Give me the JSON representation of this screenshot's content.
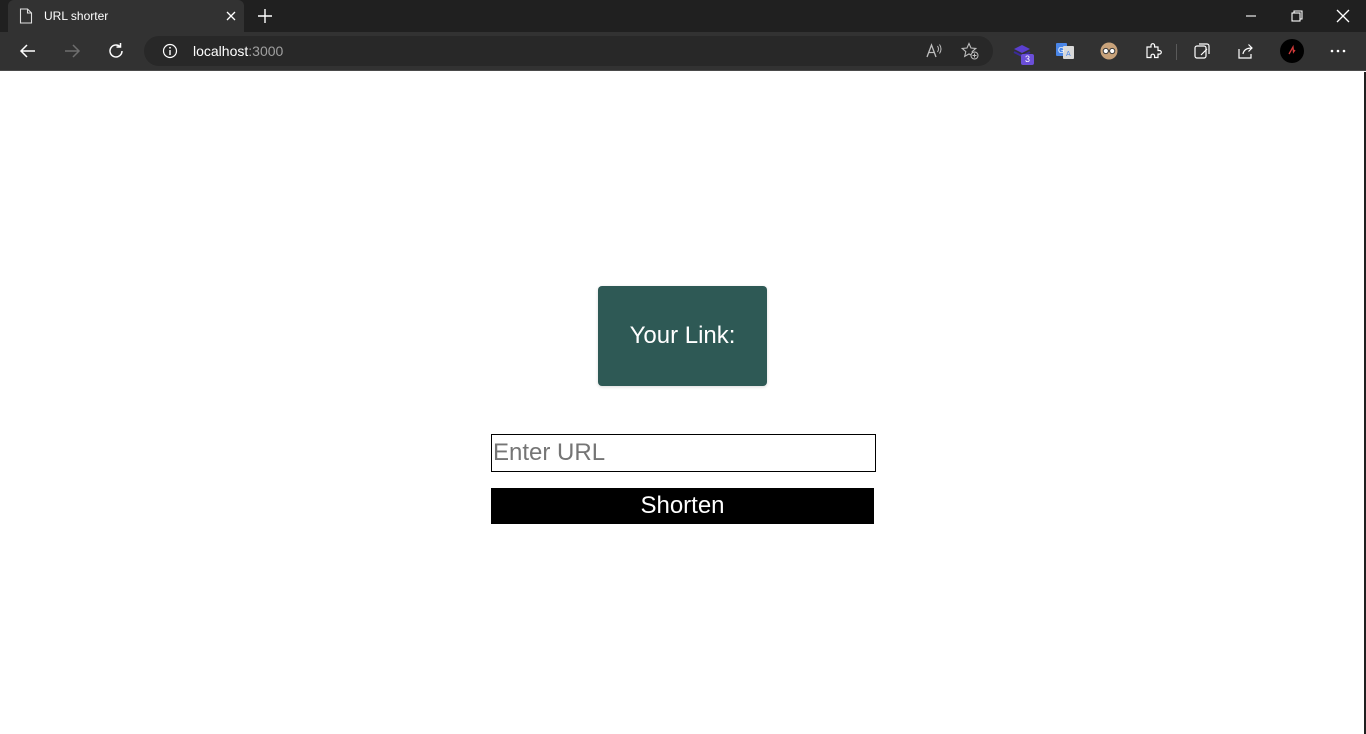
{
  "browser": {
    "tab_title": "URL shorter",
    "address_host": "localhost",
    "address_port": ":3000",
    "extension_badge": "3"
  },
  "page": {
    "link_label": "Your Link:",
    "url_input_placeholder": "Enter URL",
    "url_input_value": "",
    "shorten_button_label": "Shorten"
  },
  "colors": {
    "chrome_dark": "#202020",
    "toolbar": "#323232",
    "card_bg": "#2e5955",
    "button_bg": "#000000"
  },
  "icons": {
    "tab": "page-icon",
    "close_tab": "close-icon",
    "new_tab": "plus-icon",
    "back": "back-arrow-icon",
    "forward": "forward-arrow-icon",
    "reload": "reload-icon",
    "site_info": "info-icon",
    "read_aloud": "read-aloud-icon",
    "favorite": "favorite-add-icon",
    "extensions": "puzzle-icon",
    "collections": "collections-icon",
    "share": "share-icon",
    "menu": "more-icon"
  }
}
